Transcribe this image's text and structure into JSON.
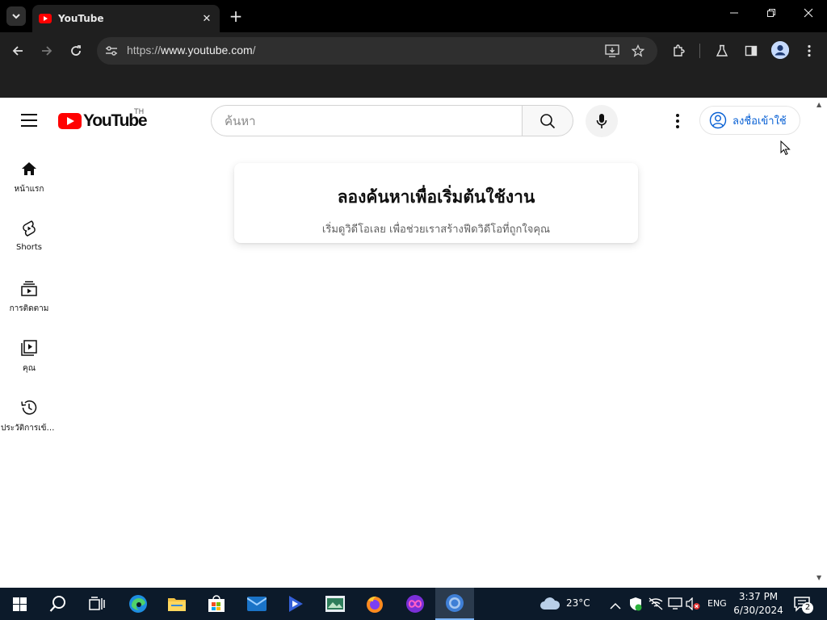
{
  "browser": {
    "tab": {
      "title": "YouTube",
      "favicon": "youtube-icon"
    },
    "url_prefix": "https://",
    "url_host": "www.youtube.com",
    "url_path": "/",
    "window_controls": [
      "minimize-icon",
      "restore-icon",
      "close-icon"
    ]
  },
  "youtube": {
    "logo_text": "YouTube",
    "country_code": "TH",
    "search_placeholder": "ค้นหา",
    "signin_label": "ลงชื่อเข้าใช้",
    "brand_color": "#ff0000",
    "link_color": "#065fd4"
  },
  "guide": {
    "items": [
      {
        "label": "หน้าแรก",
        "icon": "home-icon"
      },
      {
        "label": "Shorts",
        "icon": "shorts-icon"
      },
      {
        "label": "การติดตาม",
        "icon": "subscriptions-icon"
      },
      {
        "label": "คุณ",
        "icon": "you-icon"
      },
      {
        "label": "ประวัติการเข้าชม",
        "icon": "history-icon"
      }
    ]
  },
  "prompt": {
    "title": "ลองค้นหาเพื่อเริ่มต้นใช้งาน",
    "subtitle": "เริ่มดูวิดีโอเลย เพื่อช่วยเราสร้างฟีดวิดีโอที่ถูกใจคุณ"
  },
  "taskbar": {
    "weather": "23°C",
    "language": "ENG",
    "time": "3:37 PM",
    "date": "6/30/2024",
    "notification_count": "2",
    "apps": [
      "start-icon",
      "search-icon",
      "task-view-icon",
      "edge-icon",
      "file-explorer-icon",
      "store-icon",
      "mail-icon",
      "media-player-icon",
      "image-viewer-icon",
      "firefox-icon",
      "copilot-icon",
      "chrome-icon"
    ]
  }
}
